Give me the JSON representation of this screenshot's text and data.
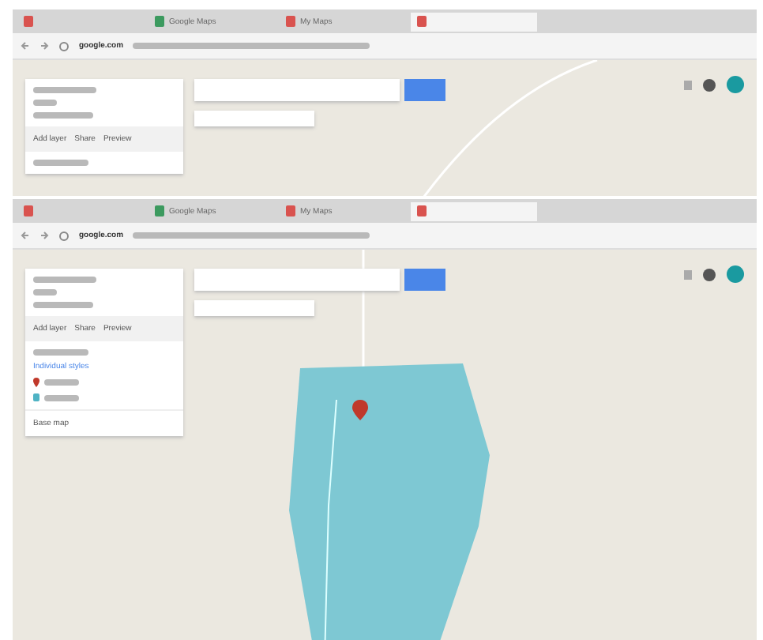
{
  "windows": [
    {
      "kind": "road",
      "tabs": [
        {
          "selected": false
        },
        {
          "label": "Google Maps",
          "selected": false
        },
        {
          "label": "My Maps",
          "selected": false
        },
        {
          "selected": true
        }
      ],
      "url_host": "google.com",
      "panel": {
        "actions": [
          "Add layer",
          "Share",
          "Preview"
        ]
      }
    },
    {
      "kind": "area",
      "tabs": [
        {
          "selected": false
        },
        {
          "label": "Google Maps",
          "selected": false
        },
        {
          "label": "My Maps",
          "selected": false
        },
        {
          "selected": true
        }
      ],
      "url_host": "google.com",
      "panel": {
        "actions": [
          "Add layer",
          "Share",
          "Preview"
        ],
        "layer_items": [
          {
            "kind": "style",
            "text": "Individual styles"
          },
          {
            "kind": "pin"
          },
          {
            "kind": "area"
          }
        ],
        "base_map": "Base map"
      }
    }
  ]
}
